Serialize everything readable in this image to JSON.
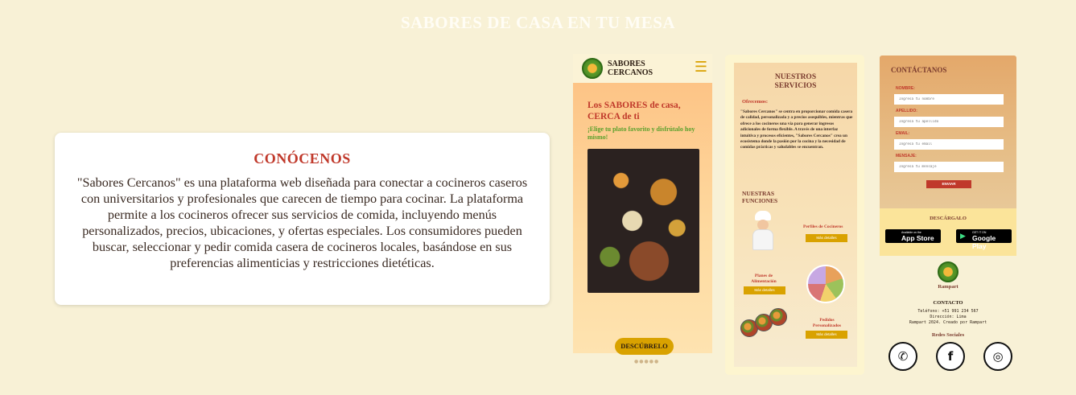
{
  "page": {
    "title": "SABORES DE CASA EN TU MESA"
  },
  "about": {
    "title": "CONÓCENOS",
    "text": "\"Sabores Cercanos\" es una plataforma web diseñada para conectar a cocineros caseros con universitarios y profesionales que carecen de tiempo para cocinar. La plataforma permite a los cocineros ofrecer sus servicios de comida, incluyendo menús personalizados, precios, ubicaciones, y ofertas especiales. Los consumidores pueden buscar, seleccionar y pedir comida casera de cocineros locales, basándose en sus preferencias alimenticias y restricciones dietéticas."
  },
  "mock_home": {
    "brand": "SABORES\nCERCANOS",
    "menu_icon": "☰",
    "headline": "Los SABORES de casa, CERCA de ti",
    "subheadline": "¡Elige tu plato favorito y disfrútalo hoy mismo!",
    "cta": "DESCÚBRELO",
    "dots": "●●●●●"
  },
  "mock_services": {
    "title": "NUESTROS\nSERVICIOS",
    "offer_label": "Ofrecemos:",
    "offer_text": "\"Sabores Cercanos\" se centra en proporcionar comida casera de calidad, personalizada y a precios asequibles, mientras que ofrece a los cocineros una vía para generar ingresos adicionales de forma flexible. A través de una interfaz intuitiva y procesos eficientes, \"Sabores Cercanos\" crea un ecosistema donde la pasión por la cocina y la necesidad de comidas prácticas y saludables se encuentran.",
    "functions_title": "NUESTRAS\nFUNCIONES",
    "features": [
      {
        "label": "Perfiles de Cocineros",
        "button": "Más detalles"
      },
      {
        "label": "Planes de\nAlimentación",
        "button": "Más detalles"
      },
      {
        "label": "Pedidos\nPersonalizados",
        "button": "Más detalles"
      }
    ]
  },
  "mock_contact": {
    "title": "CONTÁCTANOS",
    "fields": [
      {
        "label": "NOMBRE:",
        "placeholder": "Ingresa tu nombre"
      },
      {
        "label": "APELLIDO:",
        "placeholder": "Ingresa tu apellido"
      },
      {
        "label": "EMAIL:",
        "placeholder": "Ingresa tu email"
      },
      {
        "label": "MENSAJE:",
        "placeholder": "Ingresa tu mensaje"
      }
    ],
    "send": "ENVIAR",
    "download_title": "DESCÁRGALO",
    "app_store": {
      "small": "Available on the",
      "big": "App Store",
      "icon": ""
    },
    "google_play": {
      "small": "GET IT ON",
      "big": "Google Play",
      "icon": "▶"
    },
    "company": "Rampart",
    "contact_title": "CONTACTO",
    "phone": "Teléfono: +51 991 234 567",
    "address": "Dirección: Lima",
    "copyright": "Rampart 2024. Creado por Rampart",
    "social_title": "Redes Sociales",
    "social": [
      {
        "name": "whatsapp-icon",
        "glyph": "✆"
      },
      {
        "name": "facebook-icon",
        "glyph": "f"
      },
      {
        "name": "instagram-icon",
        "glyph": "◎"
      }
    ]
  },
  "colors": {
    "background": "#f8f1d6",
    "accent_red": "#c0392b",
    "accent_gold": "#d9a200",
    "accent_green": "#5aa02c"
  }
}
